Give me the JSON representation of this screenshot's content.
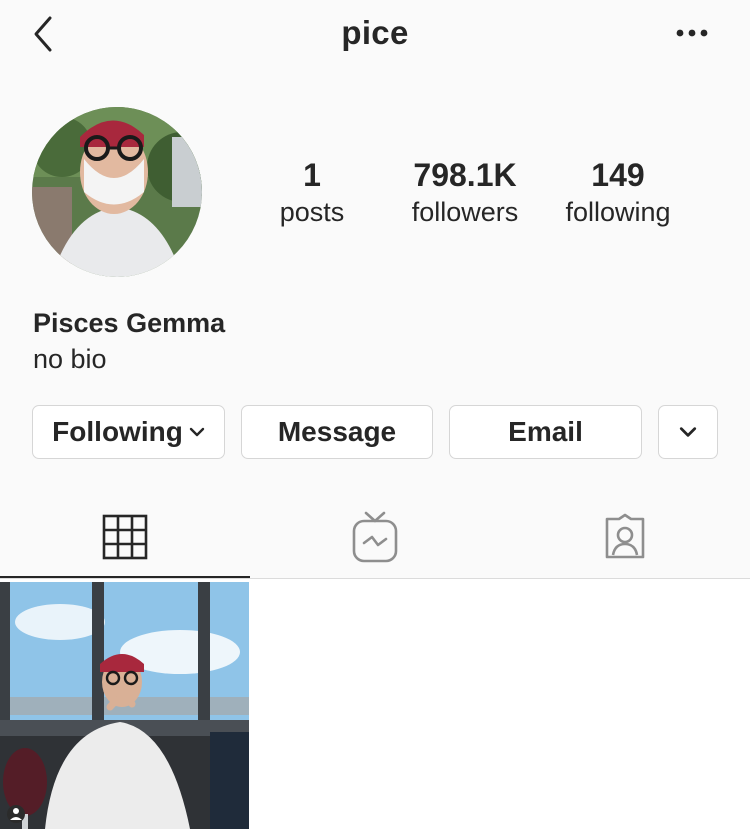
{
  "header": {
    "username": "pice",
    "back_icon": "chevron-left-icon",
    "more_icon": "more-horizontal-icon"
  },
  "profile": {
    "full_name": "Pisces Gemma",
    "bio": "no bio"
  },
  "stats": [
    {
      "value": "1",
      "label": "posts"
    },
    {
      "value": "798.1K",
      "label": "followers"
    },
    {
      "value": "149",
      "label": "following"
    }
  ],
  "actions": {
    "following_label": "Following",
    "message_label": "Message",
    "email_label": "Email"
  },
  "tabs": [
    {
      "icon": "grid-icon",
      "active": true
    },
    {
      "icon": "igtv-icon",
      "active": false
    },
    {
      "icon": "tagged-icon",
      "active": false
    }
  ],
  "colors": {
    "text": "#262626",
    "border": "#d6d6d6",
    "background": "#fafafa"
  }
}
